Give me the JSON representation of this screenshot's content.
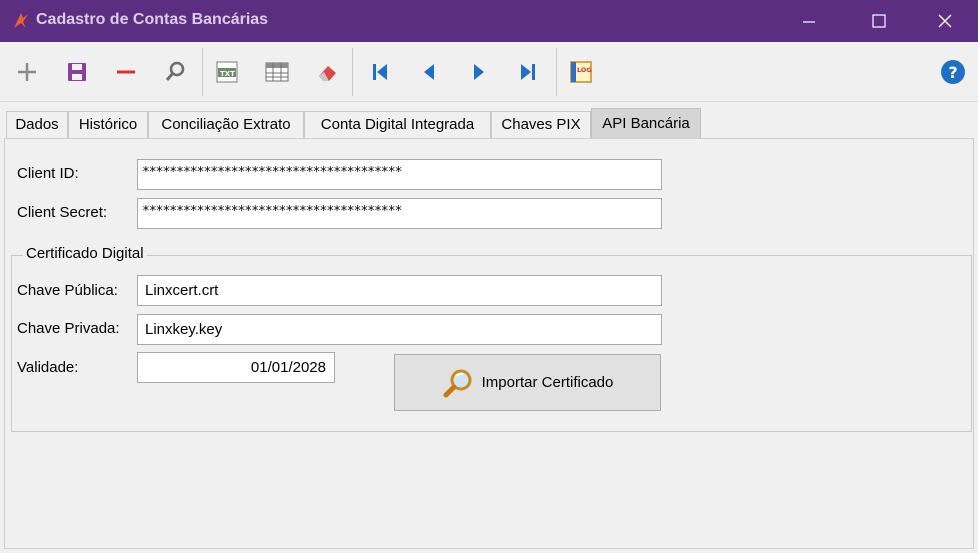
{
  "window": {
    "title": "Cadastro de Contas Bancárias"
  },
  "toolbar": {
    "buttons": [
      {
        "icon": "plus-icon"
      },
      {
        "icon": "save-icon"
      },
      {
        "icon": "minus-icon"
      },
      {
        "icon": "search-icon"
      },
      {
        "icon": "txt-export-icon"
      },
      {
        "icon": "grid-icon"
      },
      {
        "icon": "eraser-icon"
      },
      {
        "icon": "first-record-icon"
      },
      {
        "icon": "previous-record-icon"
      },
      {
        "icon": "next-record-icon"
      },
      {
        "icon": "last-record-icon"
      },
      {
        "icon": "log-icon"
      },
      {
        "icon": "help-icon"
      }
    ],
    "txt_label": "TXT",
    "log_label": "LOG",
    "help_label": "?"
  },
  "tabs": [
    {
      "label": "Dados"
    },
    {
      "label": "Histórico"
    },
    {
      "label": "Conciliação Extrato"
    },
    {
      "label": "Conta Digital Integrada"
    },
    {
      "label": "Chaves PIX"
    },
    {
      "label": "API Bancária",
      "active": true
    }
  ],
  "form": {
    "client_id_label": "Client ID:",
    "client_id_value": "**************************************",
    "client_secret_label": "Client Secret:",
    "client_secret_value": "**************************************",
    "certificate_group": "Certificado Digital",
    "public_key_label": "Chave Pública:",
    "public_key_value": "Linxcert.crt",
    "private_key_label": "Chave Privada:",
    "private_key_value": "Linxkey.key",
    "validity_label": "Validade:",
    "validity_value": "01/01/2028",
    "import_button": "Importar Certificado"
  },
  "colors": {
    "titlebar": "#5c2e82",
    "accent_blue": "#1f6fc5",
    "save_purple": "#8a3f9a",
    "minus_red": "#d9342b"
  }
}
